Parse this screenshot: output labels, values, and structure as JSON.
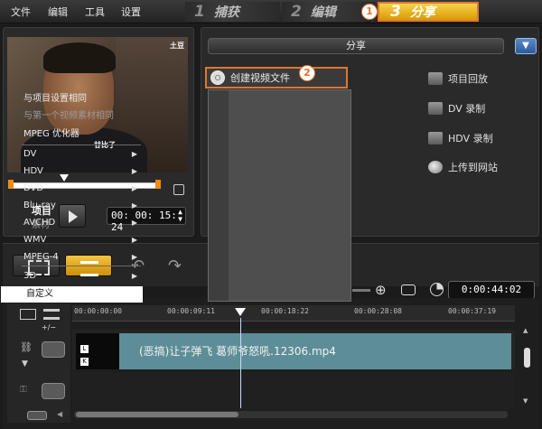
{
  "menubar": {
    "file": "文件",
    "edit": "编辑",
    "tools": "工具",
    "settings": "设置"
  },
  "steps": [
    {
      "num": "1",
      "label": "捕获"
    },
    {
      "num": "2",
      "label": "编辑"
    },
    {
      "num": "3",
      "label": "分享"
    }
  ],
  "annotations": {
    "one": "1",
    "two": "2"
  },
  "preview": {
    "watermark_top": "土豆",
    "watermark_bottom": "甘比了",
    "label_project": "项目",
    "label_clip": "素材",
    "timecode": "00: 00: 15: 24"
  },
  "share": {
    "title": "分享",
    "create_file": "创建视频文件",
    "project_playback": "项目回放",
    "dv_record": "DV 录制",
    "hdv_record": "HDV 录制",
    "upload_web": "上传到网站"
  },
  "dropdown": {
    "items": [
      {
        "label": "与项目设置相同",
        "disabled": false,
        "submenu": false
      },
      {
        "label": "与第一个视频素材相同",
        "disabled": true,
        "submenu": false
      },
      {
        "label": "MPEG 优化器",
        "disabled": false,
        "submenu": false
      },
      {
        "label": "DV",
        "disabled": false,
        "submenu": true
      },
      {
        "label": "HDV",
        "disabled": false,
        "submenu": true
      },
      {
        "label": "DVD",
        "disabled": false,
        "submenu": true
      },
      {
        "label": "Blu-ray",
        "disabled": false,
        "submenu": true
      },
      {
        "label": "AVCHD",
        "disabled": false,
        "submenu": true
      },
      {
        "label": "WMV",
        "disabled": false,
        "submenu": true
      },
      {
        "label": "MPEG-4",
        "disabled": false,
        "submenu": true
      },
      {
        "label": "3D",
        "disabled": false,
        "submenu": true
      },
      {
        "label": "自定义",
        "disabled": false,
        "submenu": false
      }
    ]
  },
  "toolbar": {
    "timecode": "0:00:44:02"
  },
  "timeline": {
    "ruler": [
      "00:00:00:00",
      "00:00:09:11",
      "00:00:18:22",
      "00:00:28:08",
      "00:00:37:19"
    ],
    "track_flag": "+/−",
    "clip_name": "(恶搞)让子弹飞 葛师爷怒吼.12306.mp4",
    "clip_badges": [
      "L",
      "K"
    ]
  },
  "colors": {
    "accent": "#e0762e",
    "active_tab": "#f0b52a",
    "clip": "#5d8e97"
  }
}
